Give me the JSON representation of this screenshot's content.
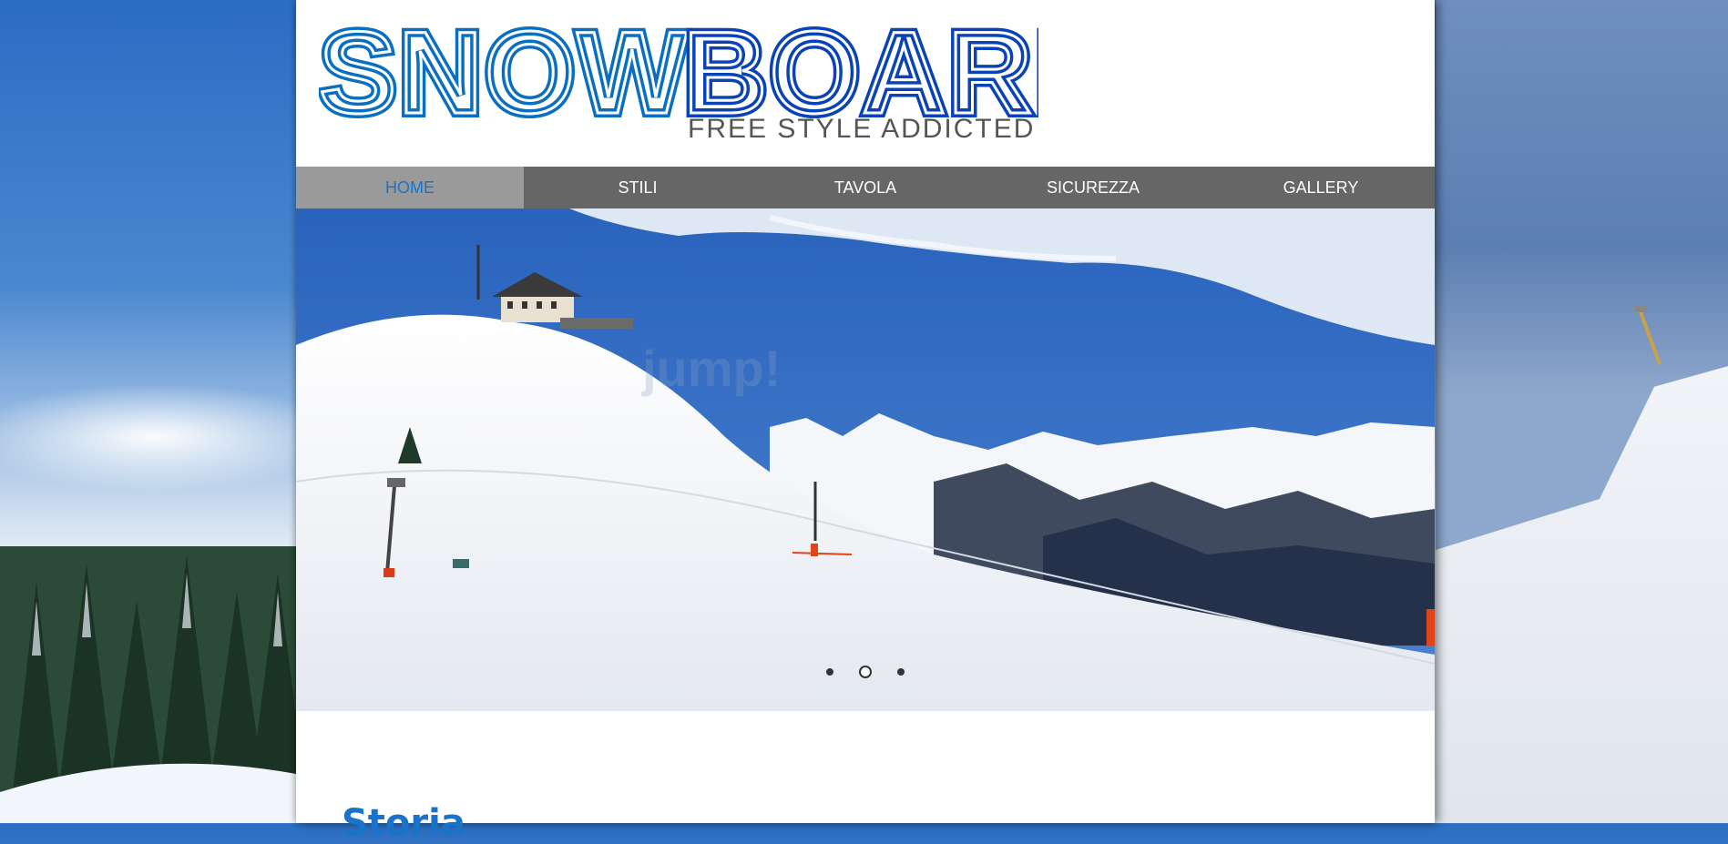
{
  "brand": {
    "logo_text_part1": "SNOW",
    "logo_text_part2": "BOARD",
    "tagline": "FREE STYLE ADDICTED",
    "colors": {
      "snow": "#0b6fc1",
      "board": "#0a43b8",
      "accent": "#1a73c9"
    }
  },
  "nav": {
    "items": [
      {
        "label": "HOME",
        "active": true
      },
      {
        "label": "STILI",
        "active": false
      },
      {
        "label": "TAVOLA",
        "active": false
      },
      {
        "label": "SICUREZZA",
        "active": false
      },
      {
        "label": "GALLERY",
        "active": false
      }
    ]
  },
  "slider": {
    "slides_count": 3,
    "active_index": 1
  },
  "content": {
    "heading": "Storia"
  }
}
